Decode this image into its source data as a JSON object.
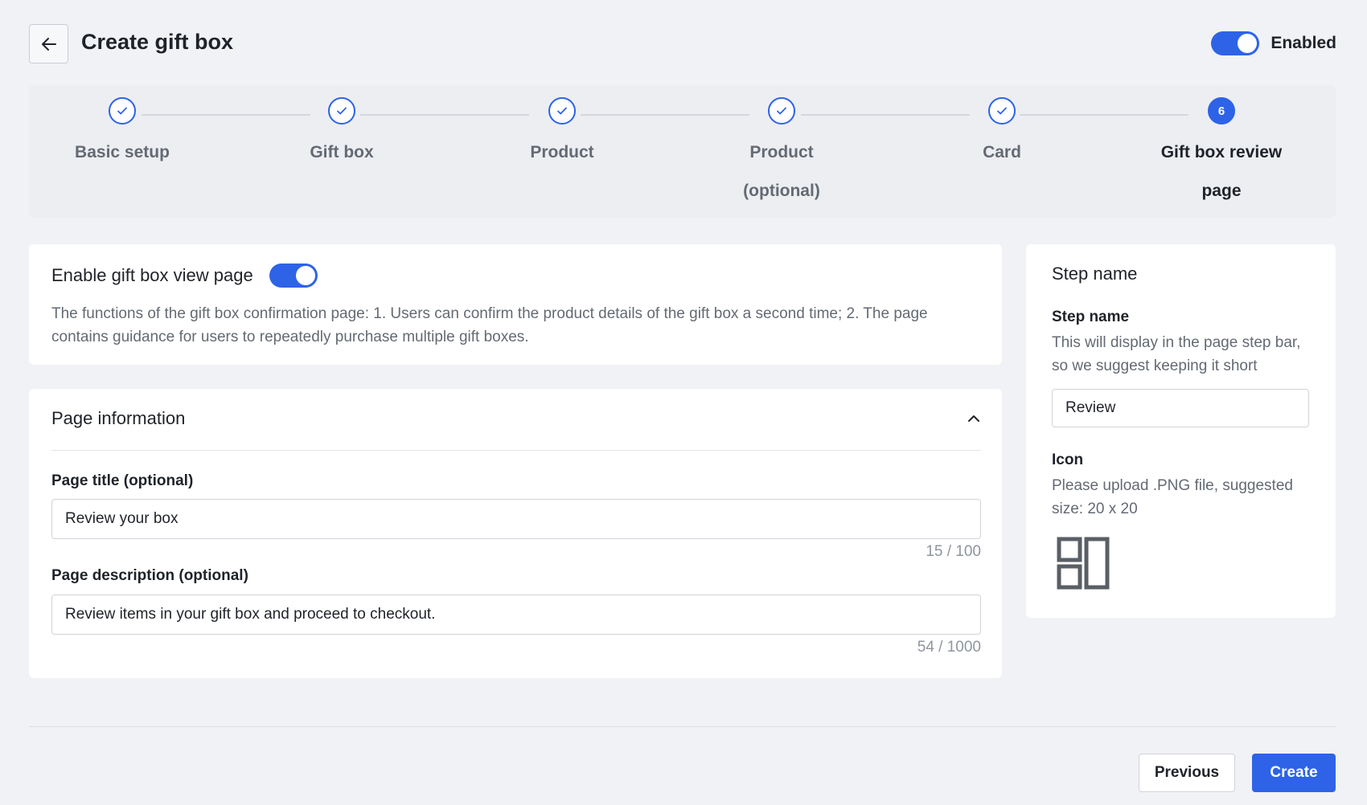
{
  "header": {
    "title": "Create gift box",
    "enabled_label": "Enabled",
    "enabled_on": true
  },
  "stepper": {
    "steps": [
      {
        "label": "Basic setup",
        "status": "done"
      },
      {
        "label": "Gift box",
        "status": "done"
      },
      {
        "label": "Product",
        "status": "done"
      },
      {
        "label": "Product (optional)",
        "status": "done"
      },
      {
        "label": "Card",
        "status": "done"
      },
      {
        "label": "Gift box review page",
        "status": "active",
        "number": "6"
      }
    ]
  },
  "enable_card": {
    "title": "Enable gift box view page",
    "toggle_on": true,
    "description": "The functions of the gift box confirmation page: 1. Users can confirm the product details of the gift box a second time; 2. The page contains guidance for users to repeatedly purchase multiple gift boxes."
  },
  "page_info": {
    "title": "Page information",
    "page_title_label": "Page title (optional)",
    "page_title_value": "Review your box",
    "page_title_counter": "15 / 100",
    "page_desc_label": "Page description (optional)",
    "page_desc_value": "Review items in your gift box and proceed to checkout.",
    "page_desc_counter": "54 / 1000"
  },
  "side": {
    "title": "Step name",
    "step_name_label": "Step name",
    "step_name_desc": "This will display in the page step bar, so we suggest keeping it short",
    "step_name_value": "Review",
    "icon_label": "Icon",
    "icon_desc": "Please upload .PNG file, suggested size: 20 x 20",
    "icon_name": "layout-panels-icon"
  },
  "footer": {
    "previous_label": "Previous",
    "create_label": "Create"
  },
  "colors": {
    "accent": "#2e63e8",
    "background": "#f1f2f5",
    "muted_text": "#646a73"
  }
}
